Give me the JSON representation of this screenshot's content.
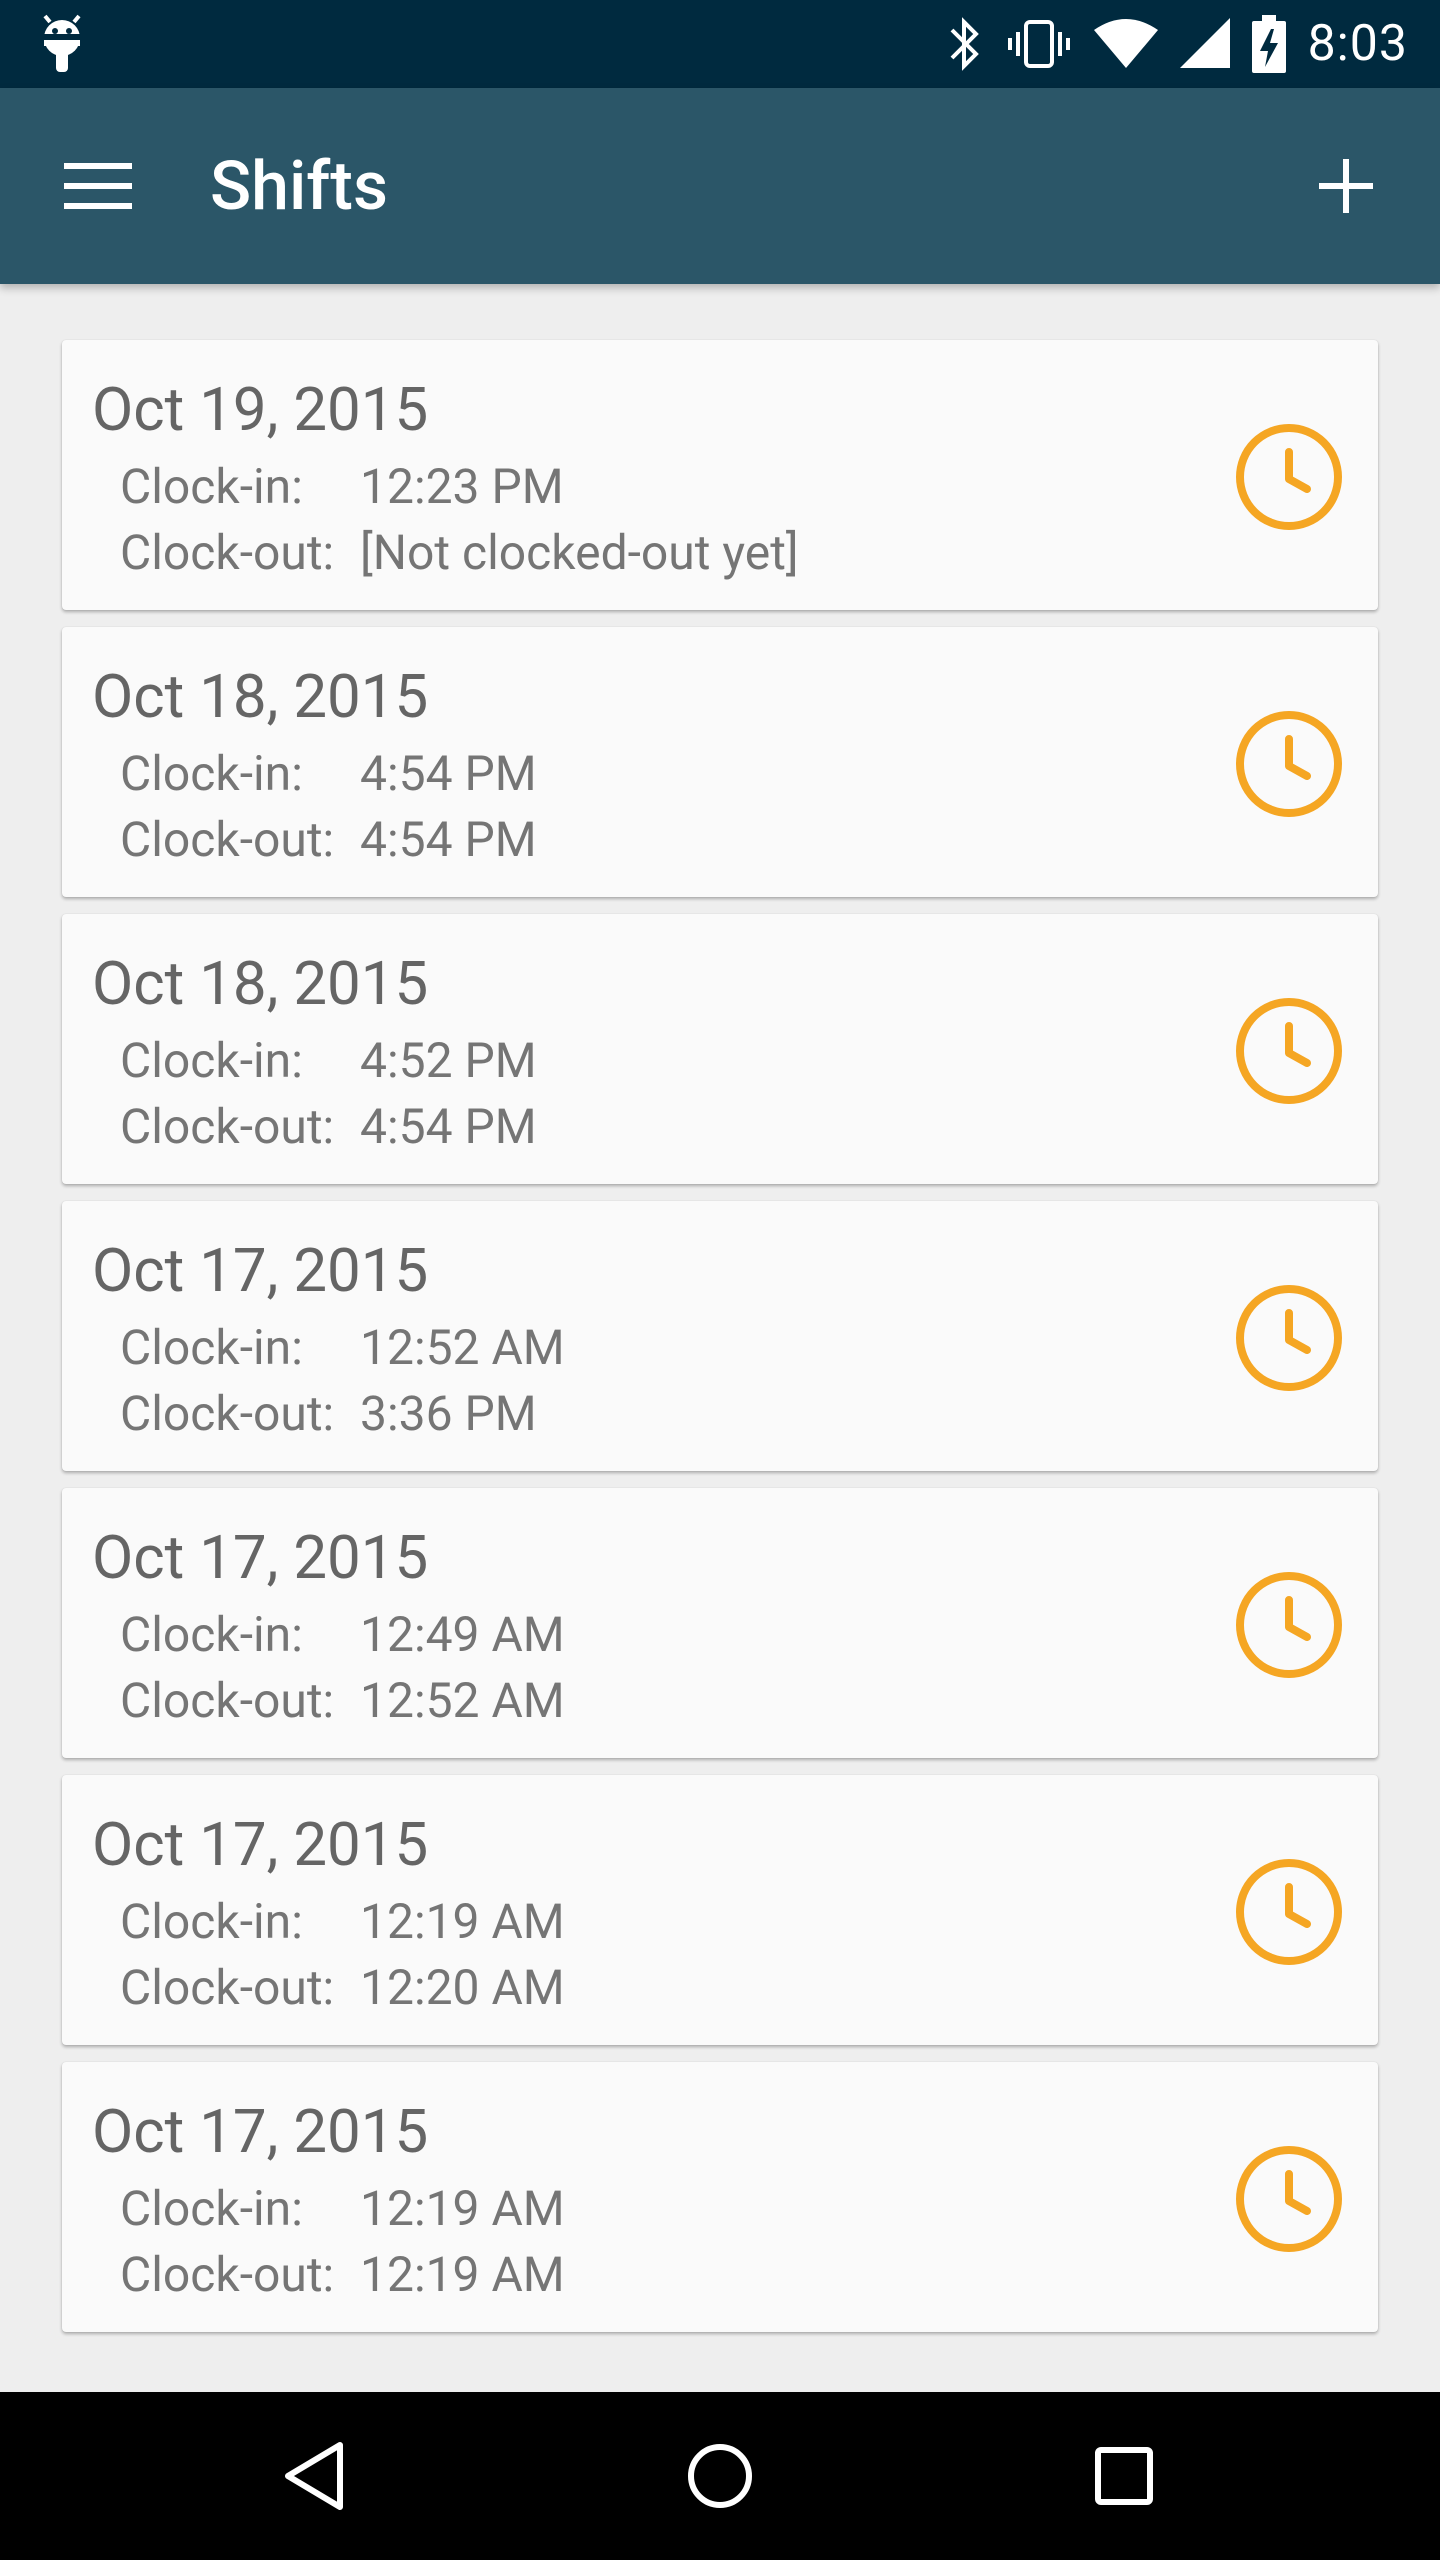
{
  "status_bar": {
    "time": "8:03",
    "icons": [
      "android-icon",
      "bluetooth-icon",
      "vibrate-icon",
      "wifi-icon",
      "signal-icon",
      "battery-charging-icon"
    ]
  },
  "app_bar": {
    "title": "Shifts",
    "menu_icon": "menu-icon",
    "add_icon": "add-icon"
  },
  "colors": {
    "status_bar_bg": "#002a3f",
    "app_bar_bg": "#2b5668",
    "accent_clock": "#f5a623",
    "page_bg": "#eeeeee"
  },
  "labels": {
    "clock_in": "Clock-in:",
    "clock_out": "Clock-out:"
  },
  "shifts": [
    {
      "date": "Oct 19, 2015",
      "clock_in": "12:23 PM",
      "clock_out": "[Not clocked-out yet]"
    },
    {
      "date": "Oct 18, 2015",
      "clock_in": "4:54 PM",
      "clock_out": "4:54 PM"
    },
    {
      "date": "Oct 18, 2015",
      "clock_in": "4:52 PM",
      "clock_out": "4:54 PM"
    },
    {
      "date": "Oct 17, 2015",
      "clock_in": "12:52 AM",
      "clock_out": "3:36 PM"
    },
    {
      "date": "Oct 17, 2015",
      "clock_in": "12:49 AM",
      "clock_out": "12:52 AM"
    },
    {
      "date": "Oct 17, 2015",
      "clock_in": "12:19 AM",
      "clock_out": "12:20 AM"
    },
    {
      "date": "Oct 17, 2015",
      "clock_in": "12:19 AM",
      "clock_out": "12:19 AM"
    }
  ],
  "nav_bar": {
    "buttons": [
      "back-icon",
      "home-icon",
      "recents-icon"
    ]
  }
}
